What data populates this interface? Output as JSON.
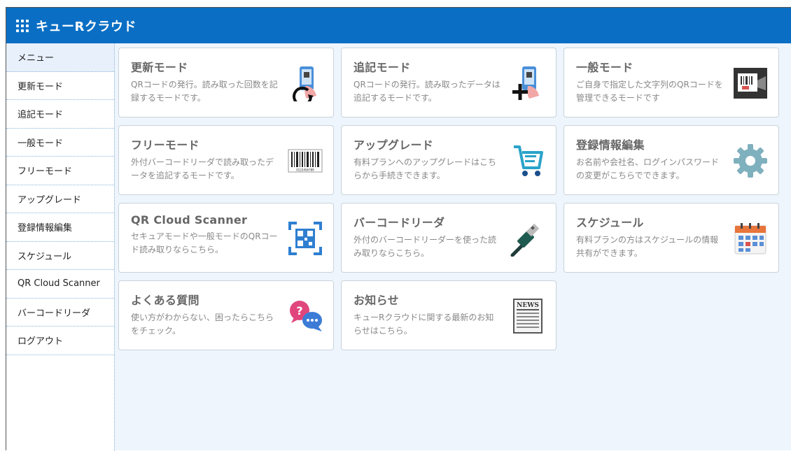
{
  "header": {
    "title": "キューRクラウド"
  },
  "sidebar": {
    "items": [
      {
        "label": "メニュー"
      },
      {
        "label": "更新モード"
      },
      {
        "label": "追記モード"
      },
      {
        "label": "一般モード"
      },
      {
        "label": "フリーモード"
      },
      {
        "label": "アップグレード"
      },
      {
        "label": "登録情報編集"
      },
      {
        "label": "スケジュール"
      },
      {
        "label": "QR Cloud Scanner"
      },
      {
        "label": "バーコードリーダ"
      },
      {
        "label": "ログアウト"
      }
    ]
  },
  "cards": [
    {
      "title": "更新モード",
      "desc": "QRコードの発行。読み取った回数を記録するモードです。",
      "icon": "phone-refresh-icon"
    },
    {
      "title": "追記モード",
      "desc": "QRコードの発行。読み取ったデータは追記するモードです。",
      "icon": "phone-plus-icon"
    },
    {
      "title": "一般モード",
      "desc": "ご自身で指定した文字列のQRコードを管理できるモードです",
      "icon": "scanner-card-icon"
    },
    {
      "title": "フリーモード",
      "desc": "外付バーコードリーダで読み取ったデータを追記するモードです。",
      "icon": "barcode-icon"
    },
    {
      "title": "アップグレード",
      "desc": "有料プランへのアップグレードはこちらから手続きできます。",
      "icon": "cart-icon"
    },
    {
      "title": "登録情報編集",
      "desc": "お名前や会社名、ログインパスワードの変更がこちらでできます。",
      "icon": "gear-icon"
    },
    {
      "title": "QR Cloud Scanner",
      "desc": "セキュアモードや一般モードのQRコード読み取りならこちら。",
      "icon": "qr-scan-icon"
    },
    {
      "title": "バーコードリーダ",
      "desc": "外付のバーコードリーダーを使った読み取りならこちら。",
      "icon": "usb-plug-icon"
    },
    {
      "title": "スケジュール",
      "desc": "有料プランの方はスケジュールの情報共有ができます。",
      "icon": "calendar-icon"
    },
    {
      "title": "よくある質問",
      "desc": "使い方がわからない、困ったらこちらをチェック。",
      "icon": "faq-bubbles-icon"
    },
    {
      "title": "お知らせ",
      "desc": "キューRクラウドに関する最新のお知らせはこちら。",
      "icon": "newspaper-icon"
    }
  ],
  "icon_texts": {
    "news": "NEWS",
    "barcode_digits": "0123456789"
  },
  "colors": {
    "header": "#0a6fc4",
    "background": "#eef5fc"
  }
}
